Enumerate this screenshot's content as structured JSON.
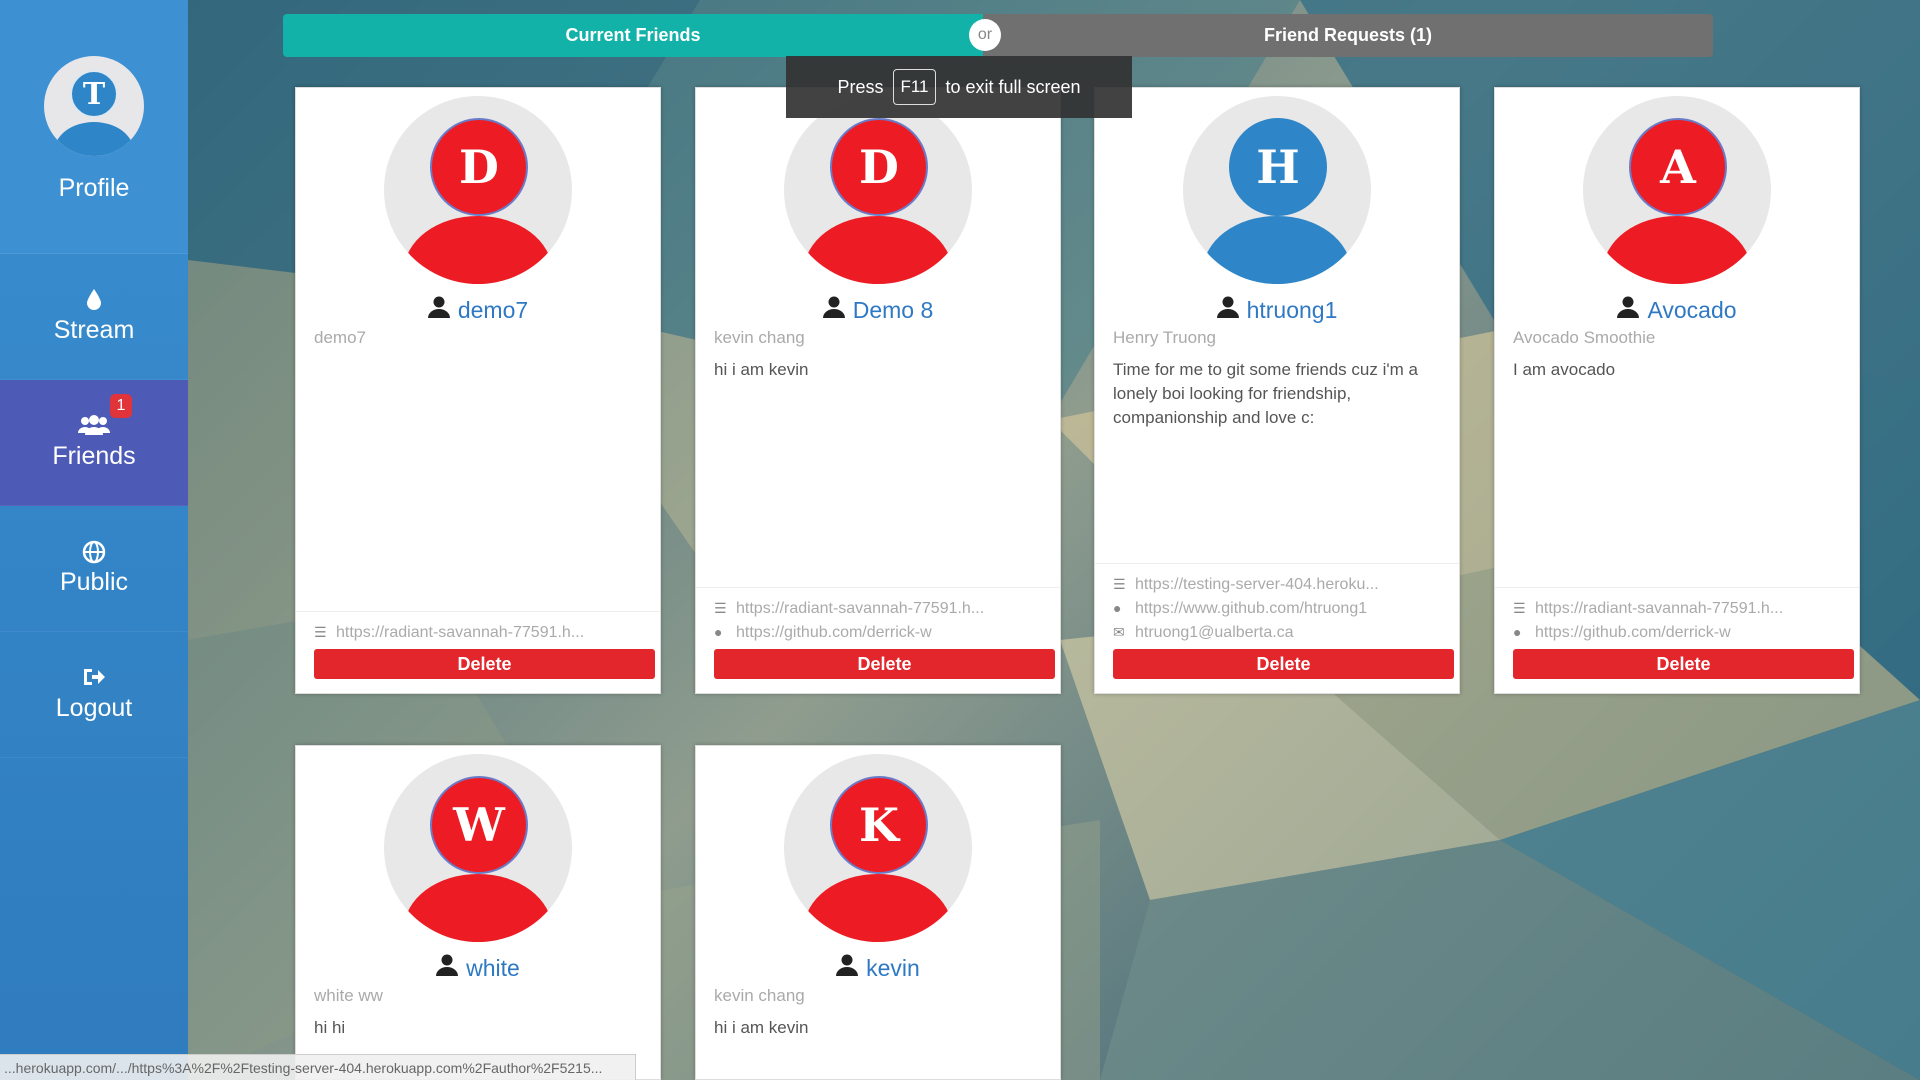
{
  "sidebar": {
    "profile": {
      "initial": "T",
      "label": "Profile"
    },
    "items": [
      {
        "label": "Stream",
        "icon": "drop-icon"
      },
      {
        "label": "Friends",
        "icon": "users-icon",
        "badge": "1"
      },
      {
        "label": "Public",
        "icon": "globe-icon"
      },
      {
        "label": "Logout",
        "icon": "sign-out-icon"
      }
    ]
  },
  "tabs": {
    "current": "Current Friends",
    "or": "or",
    "requests": "Friend Requests (1)"
  },
  "toast": {
    "pre": "Press",
    "key": "F11",
    "post": "to exit full screen"
  },
  "colors": {
    "red_avatar": "#ed1c24",
    "blue_avatar": "#2e86c8",
    "accent": "#13b2a8",
    "delete": "#e3262b"
  },
  "friends": [
    {
      "initial": "D",
      "username": "demo7",
      "display": "demo7",
      "bio": "",
      "links": [
        "https://radiant-savannah-77591.h..."
      ],
      "delete": "Delete"
    },
    {
      "initial": "D",
      "username": "Demo 8",
      "display": "kevin chang",
      "bio": "hi i am kevin",
      "links": [
        "https://radiant-savannah-77591.h...",
        "https://github.com/derrick-w"
      ],
      "delete": "Delete"
    },
    {
      "initial": "H",
      "username": "htruong1",
      "display": "Henry Truong",
      "bio": "Time for me to git some friends cuz i'm a lonely boi looking for friendship, companionship and love c:",
      "links": [
        "https://testing-server-404.heroku...",
        "https://www.github.com/htruong1",
        "htruong1@ualberta.ca"
      ],
      "delete": "Delete"
    },
    {
      "initial": "A",
      "username": "Avocado",
      "display": "Avocado Smoothie",
      "bio": "I am avocado",
      "links": [
        "https://radiant-savannah-77591.h...",
        "https://github.com/derrick-w"
      ],
      "delete": "Delete"
    },
    {
      "initial": "W",
      "username": "white",
      "display": "white ww",
      "bio": "hi hi"
    },
    {
      "initial": "K",
      "username": "kevin",
      "display": "kevin chang",
      "bio": "hi i am kevin"
    }
  ],
  "status_url": "...herokuapp.com/.../https%3A%2F%2Ftesting-server-404.herokuapp.com%2Fauthor%2F5215..."
}
